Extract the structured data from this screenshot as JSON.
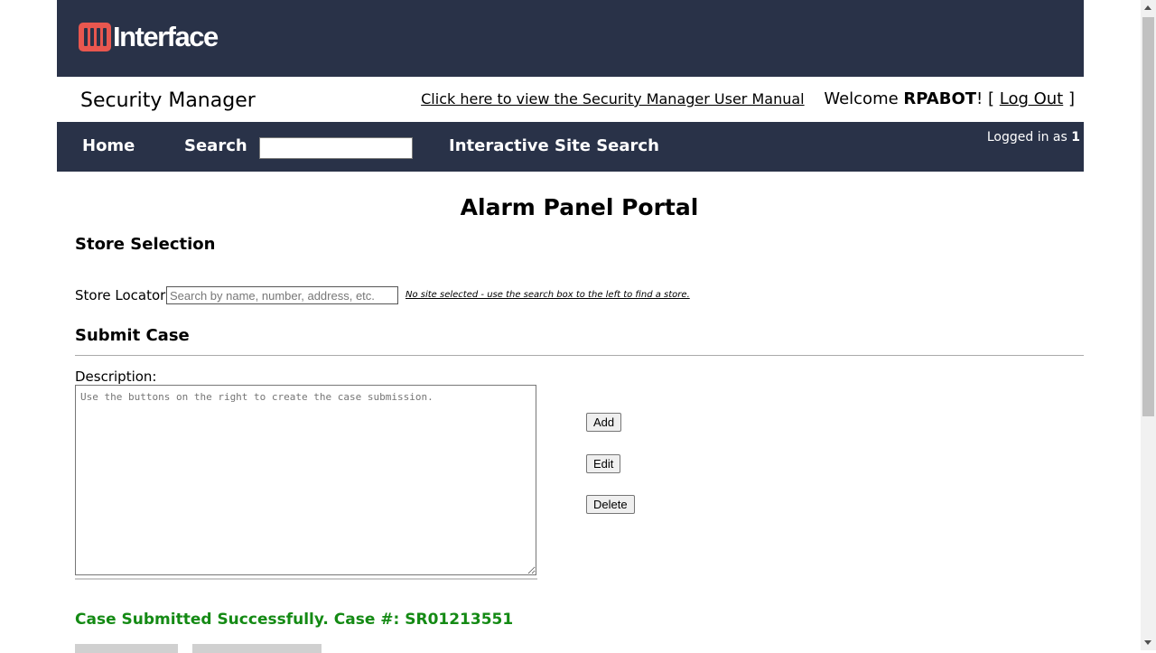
{
  "header": {
    "logo_text": "Interface",
    "brand_color": "#e8574f",
    "bar_color": "#293248"
  },
  "subheader": {
    "app_title": "Security Manager",
    "manual_link": "Click here to view the Security Manager User Manual",
    "welcome_prefix": "Welcome ",
    "username": "RPABOT",
    "welcome_suffix": "! [ ",
    "logout_label": "Log Out",
    "close_bracket": " ]"
  },
  "nav": {
    "home": "Home",
    "search": "Search",
    "search_value": "",
    "interactive_search": "Interactive Site Search",
    "logged_in_prefix": "Logged in as ",
    "logged_in_value": "1"
  },
  "main": {
    "portal_title": "Alarm Panel Portal",
    "store_selection_heading": "Store Selection",
    "store_locator_label": "Store Locator:",
    "store_locator_placeholder": "Search by name, number, address, etc.",
    "no_site_message": "No site selected - use the search box to the left to find a store.",
    "submit_case_heading": "Submit Case",
    "description_label": "Description:",
    "description_placeholder": "Use the buttons on the right to create the case submission.",
    "buttons": {
      "add": "Add",
      "edit": "Edit",
      "delete": "Delete"
    },
    "success_message": "Case Submitted Successfully. Case #: SR01213551",
    "success_color": "#148a14"
  }
}
